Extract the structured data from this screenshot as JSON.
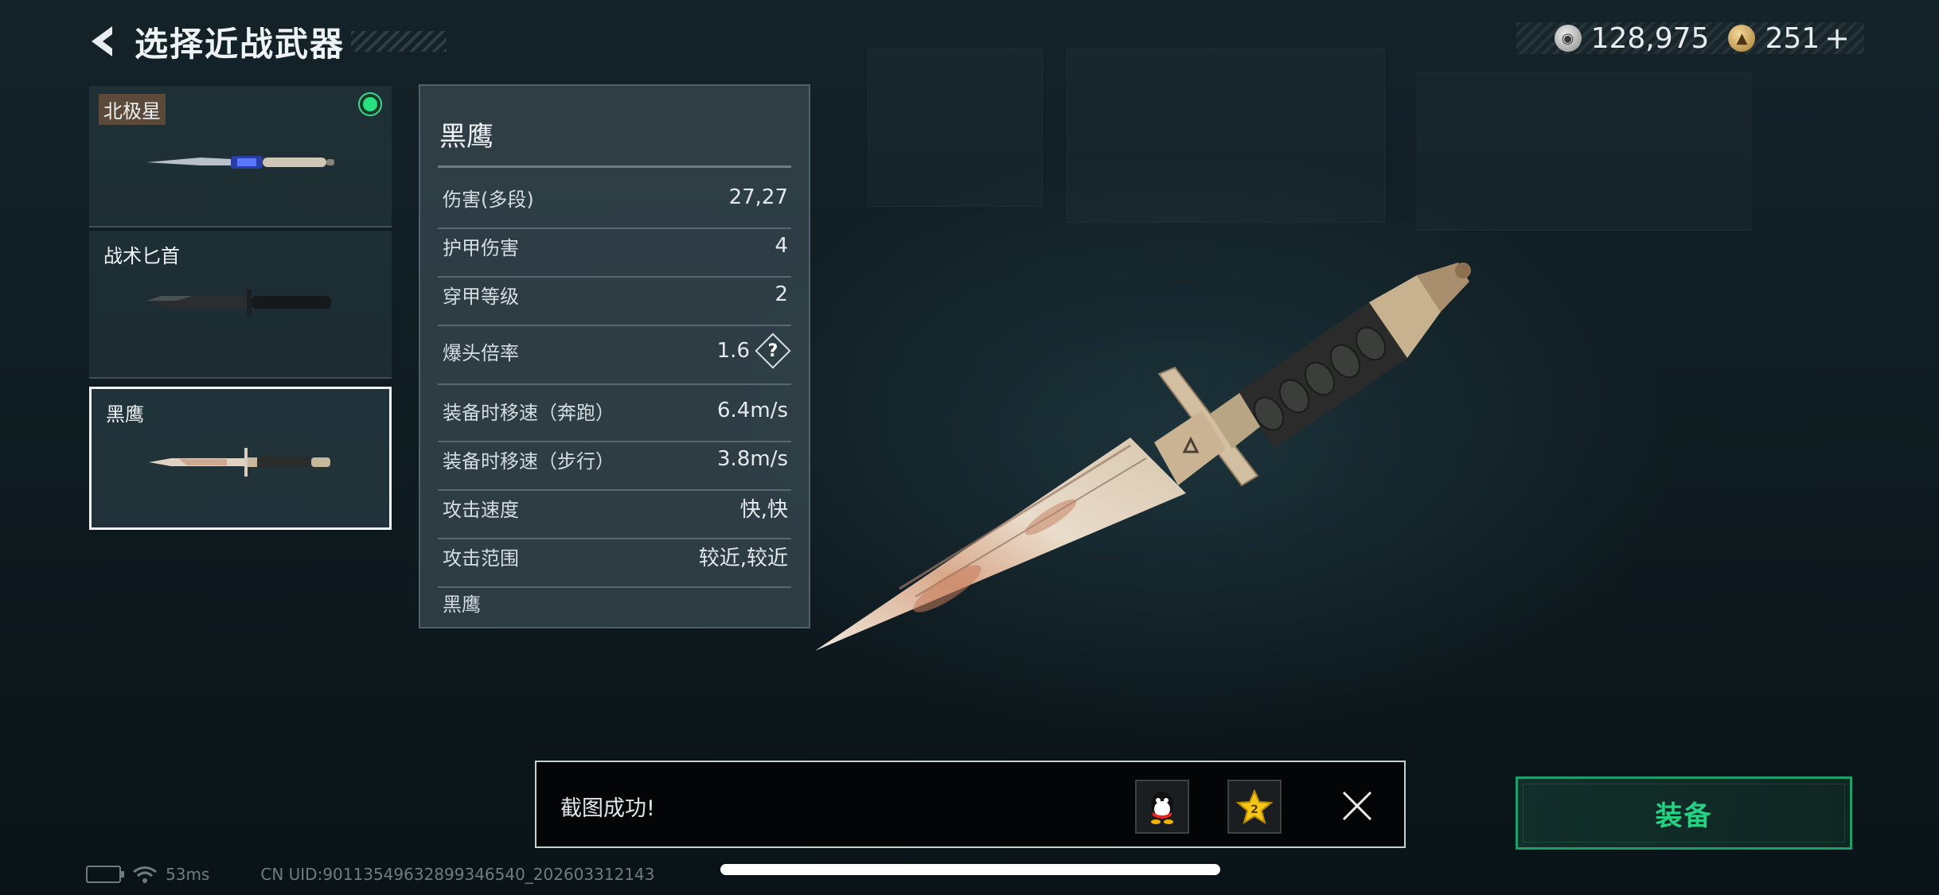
{
  "header": {
    "title": "选择近战武器"
  },
  "currency": {
    "silver": "128,975",
    "gold": "251",
    "plus": "+"
  },
  "weapons": [
    {
      "name": "北极星",
      "equipped": true,
      "selected": false
    },
    {
      "name": "战术匕首",
      "equipped": false,
      "selected": false
    },
    {
      "name": "黑鹰",
      "equipped": false,
      "selected": true
    }
  ],
  "stats": {
    "title": "黑鹰",
    "rows": [
      {
        "label": "伤害(多段)",
        "value": "27,27"
      },
      {
        "label": "护甲伤害",
        "value": "4"
      },
      {
        "label": "穿甲等级",
        "value": "2"
      },
      {
        "label": "爆头倍率",
        "value": "1.6",
        "help": "?"
      },
      {
        "label": "装备时移速（奔跑）",
        "value": "6.4m/s"
      },
      {
        "label": "装备时移速（步行）",
        "value": "3.8m/s"
      },
      {
        "label": "攻击速度",
        "value": "快,快"
      },
      {
        "label": "攻击范围",
        "value": "较近,较近"
      }
    ],
    "footer": "黑鹰"
  },
  "toast": {
    "message": "截图成功!"
  },
  "equip_button": {
    "label": "装备"
  },
  "status": {
    "ping": "53ms",
    "uid": "CN UID:90113549632899346540_202603312143"
  },
  "colors": {
    "accent_green": "#24d283",
    "equip_border": "#1f9e6b",
    "background": "#101d22"
  }
}
